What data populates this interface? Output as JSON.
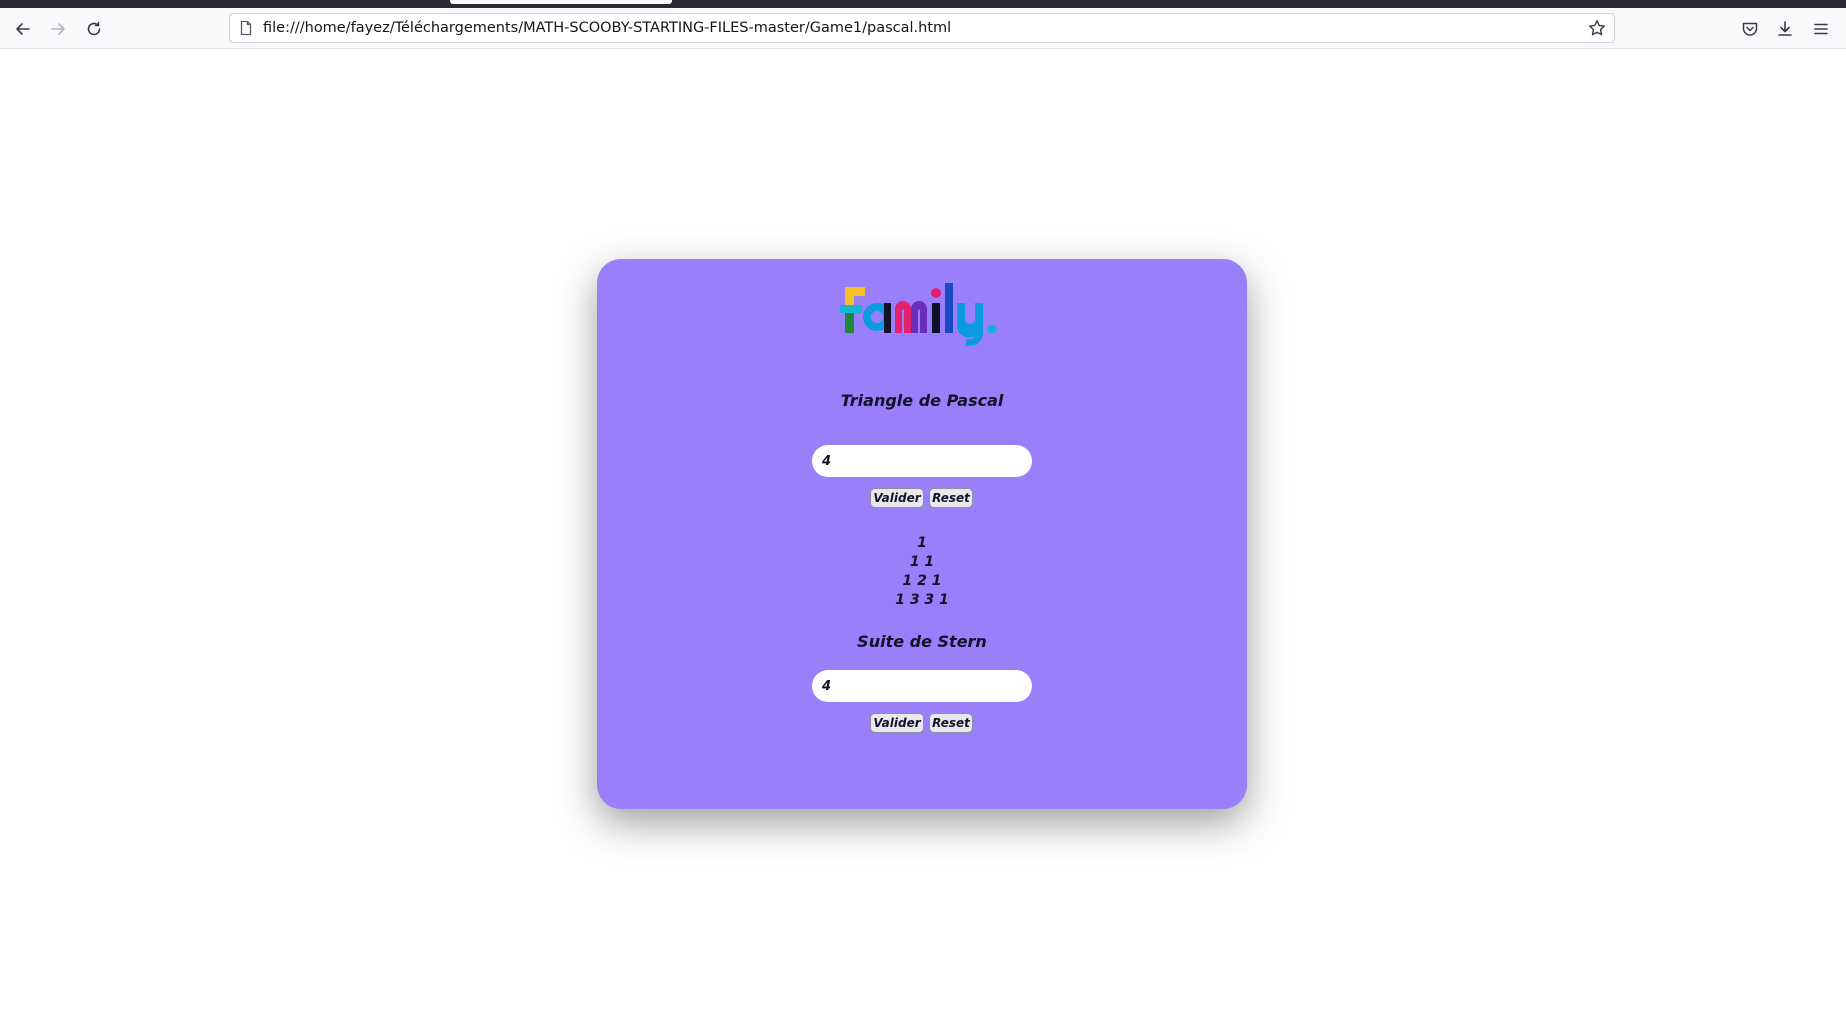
{
  "browser": {
    "url": "file:///home/fayez/Téléchargements/MATH-SCOOBY-STARTING-FILES-master/Game1/pascal.html"
  },
  "logo": {
    "text": "family",
    "letters": [
      {
        "char": "f",
        "color": "#f6c026"
      },
      {
        "char": "a",
        "color": "#0b9be0"
      },
      {
        "char": "m",
        "color": "#e3226d"
      },
      {
        "char": "i",
        "color": "#12122a"
      },
      {
        "char": "l",
        "color": "#1b48c4"
      },
      {
        "char": "y",
        "color": "#0b9be0"
      },
      {
        "char": ".",
        "color": "#12b4d8"
      }
    ]
  },
  "pascal": {
    "title": "Triangle de Pascal",
    "input_value": "4",
    "validate_label": "Valider",
    "reset_label": "Reset",
    "rows": [
      "1",
      "1 1",
      "1 2 1",
      "1 3 3 1"
    ]
  },
  "stern": {
    "title": "Suite de Stern",
    "input_value": "4",
    "validate_label": "Valider",
    "reset_label": "Reset"
  },
  "colors": {
    "card_background": "#9a7ffa",
    "text": "#12122a"
  },
  "icons": {
    "back": "arrow-left-icon",
    "forward": "arrow-right-icon",
    "reload": "reload-icon",
    "page": "page-icon",
    "bookmark": "star-icon",
    "pocket": "pocket-icon",
    "downloads": "download-icon",
    "menu": "hamburger-menu-icon"
  }
}
